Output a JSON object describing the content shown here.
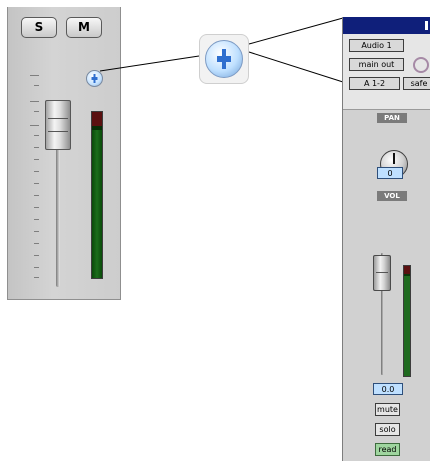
{
  "left_strip": {
    "solo_label": "S",
    "mute_label": "M",
    "pan_icon": "pan-knob-icon",
    "meter_level": 0.9
  },
  "callout": {
    "icon": "pan-knob-icon"
  },
  "channel_strip": {
    "track_name": "Audio 1",
    "output": "main out",
    "input": "A 1-2",
    "safe_label": "safe",
    "pan_label": "PAN",
    "pan_value": "0",
    "vol_label": "VOL",
    "vol_value": "0.0",
    "mute_label": "mute",
    "solo_label": "solo",
    "automation_label": "read",
    "colors": {
      "title_bar": "#0f1f7a",
      "value_box": "#bfe0ff",
      "automation_read": "#9fd59f",
      "meter_green": "#1f6a1f",
      "meter_clip": "#5a1010"
    }
  }
}
